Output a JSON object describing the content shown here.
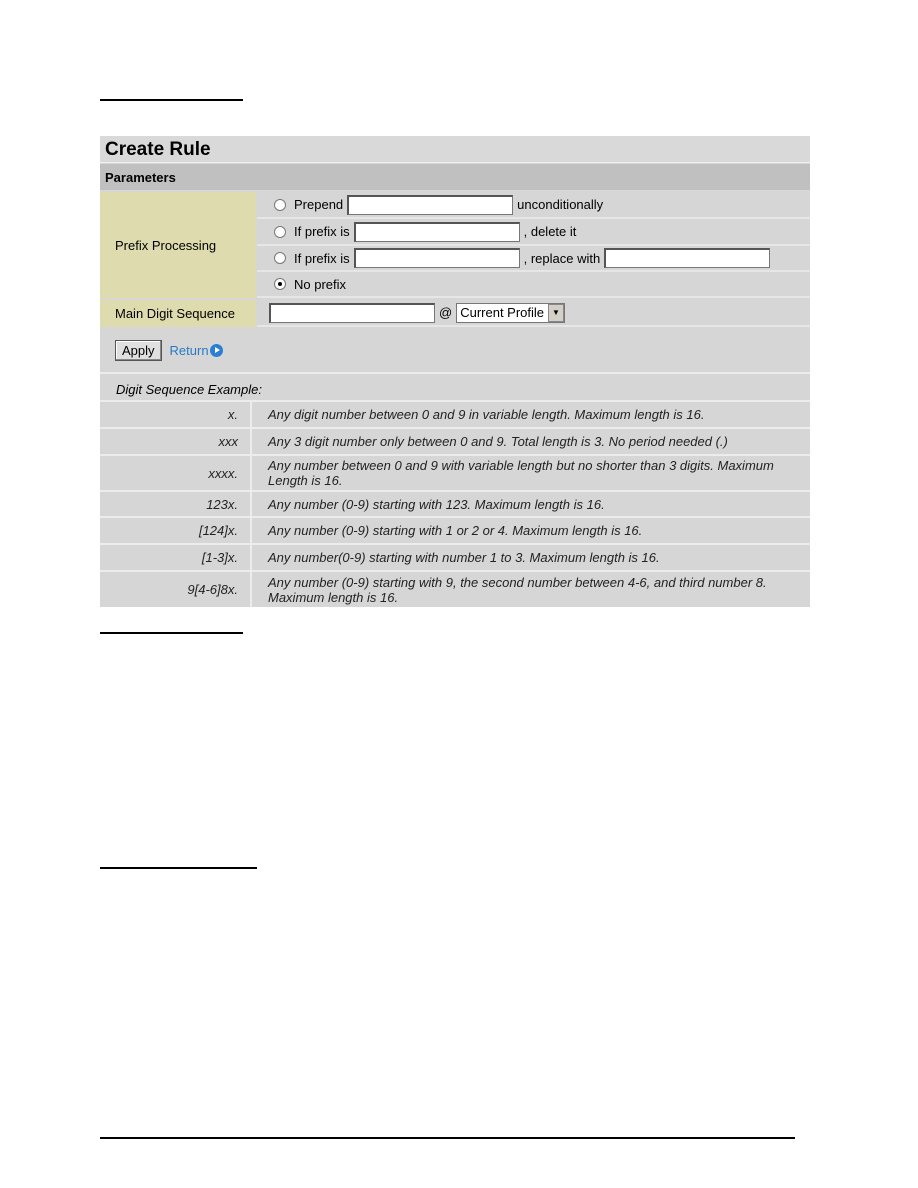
{
  "title": "Create Rule",
  "section": "Parameters",
  "prefix": {
    "label": "Prefix Processing",
    "options": [
      {
        "label": "Prepend",
        "suffix": "unconditionally",
        "selected": false
      },
      {
        "label": "If prefix is",
        "suffix": ", delete it",
        "selected": false
      },
      {
        "label": "If prefix is",
        "suffix": ", replace with",
        "selected": false
      },
      {
        "label": "No prefix",
        "selected": true
      }
    ]
  },
  "main": {
    "label": "Main Digit Sequence",
    "value": "",
    "at": "@",
    "profile": "Current Profile"
  },
  "apply_label": "Apply",
  "return_label": "Return",
  "examples_header": "Digit Sequence Example:",
  "examples": [
    {
      "k": "x.",
      "d": "Any digit number between 0 and 9 in variable length. Maximum length is 16."
    },
    {
      "k": "xxx",
      "d": "Any 3 digit number only between 0 and 9. Total length is 3. No period needed (.)"
    },
    {
      "k": "xxxx.",
      "d": "Any number between 0 and 9 with variable length but no shorter than 3 digits. Maximum Length is 16."
    },
    {
      "k": "123x.",
      "d": "Any number (0-9) starting with 123. Maximum length is 16."
    },
    {
      "k": "[124]x.",
      "d": "Any number (0-9) starting with 1 or 2 or 4. Maximum length is 16."
    },
    {
      "k": "[1-3]x.",
      "d": "Any number(0-9) starting with number 1 to 3. Maximum length is 16."
    },
    {
      "k": "9[4-6]8x.",
      "d": "Any number (0-9) starting with 9, the second number between 4-6, and third number 8. Maximum length is 16."
    }
  ]
}
